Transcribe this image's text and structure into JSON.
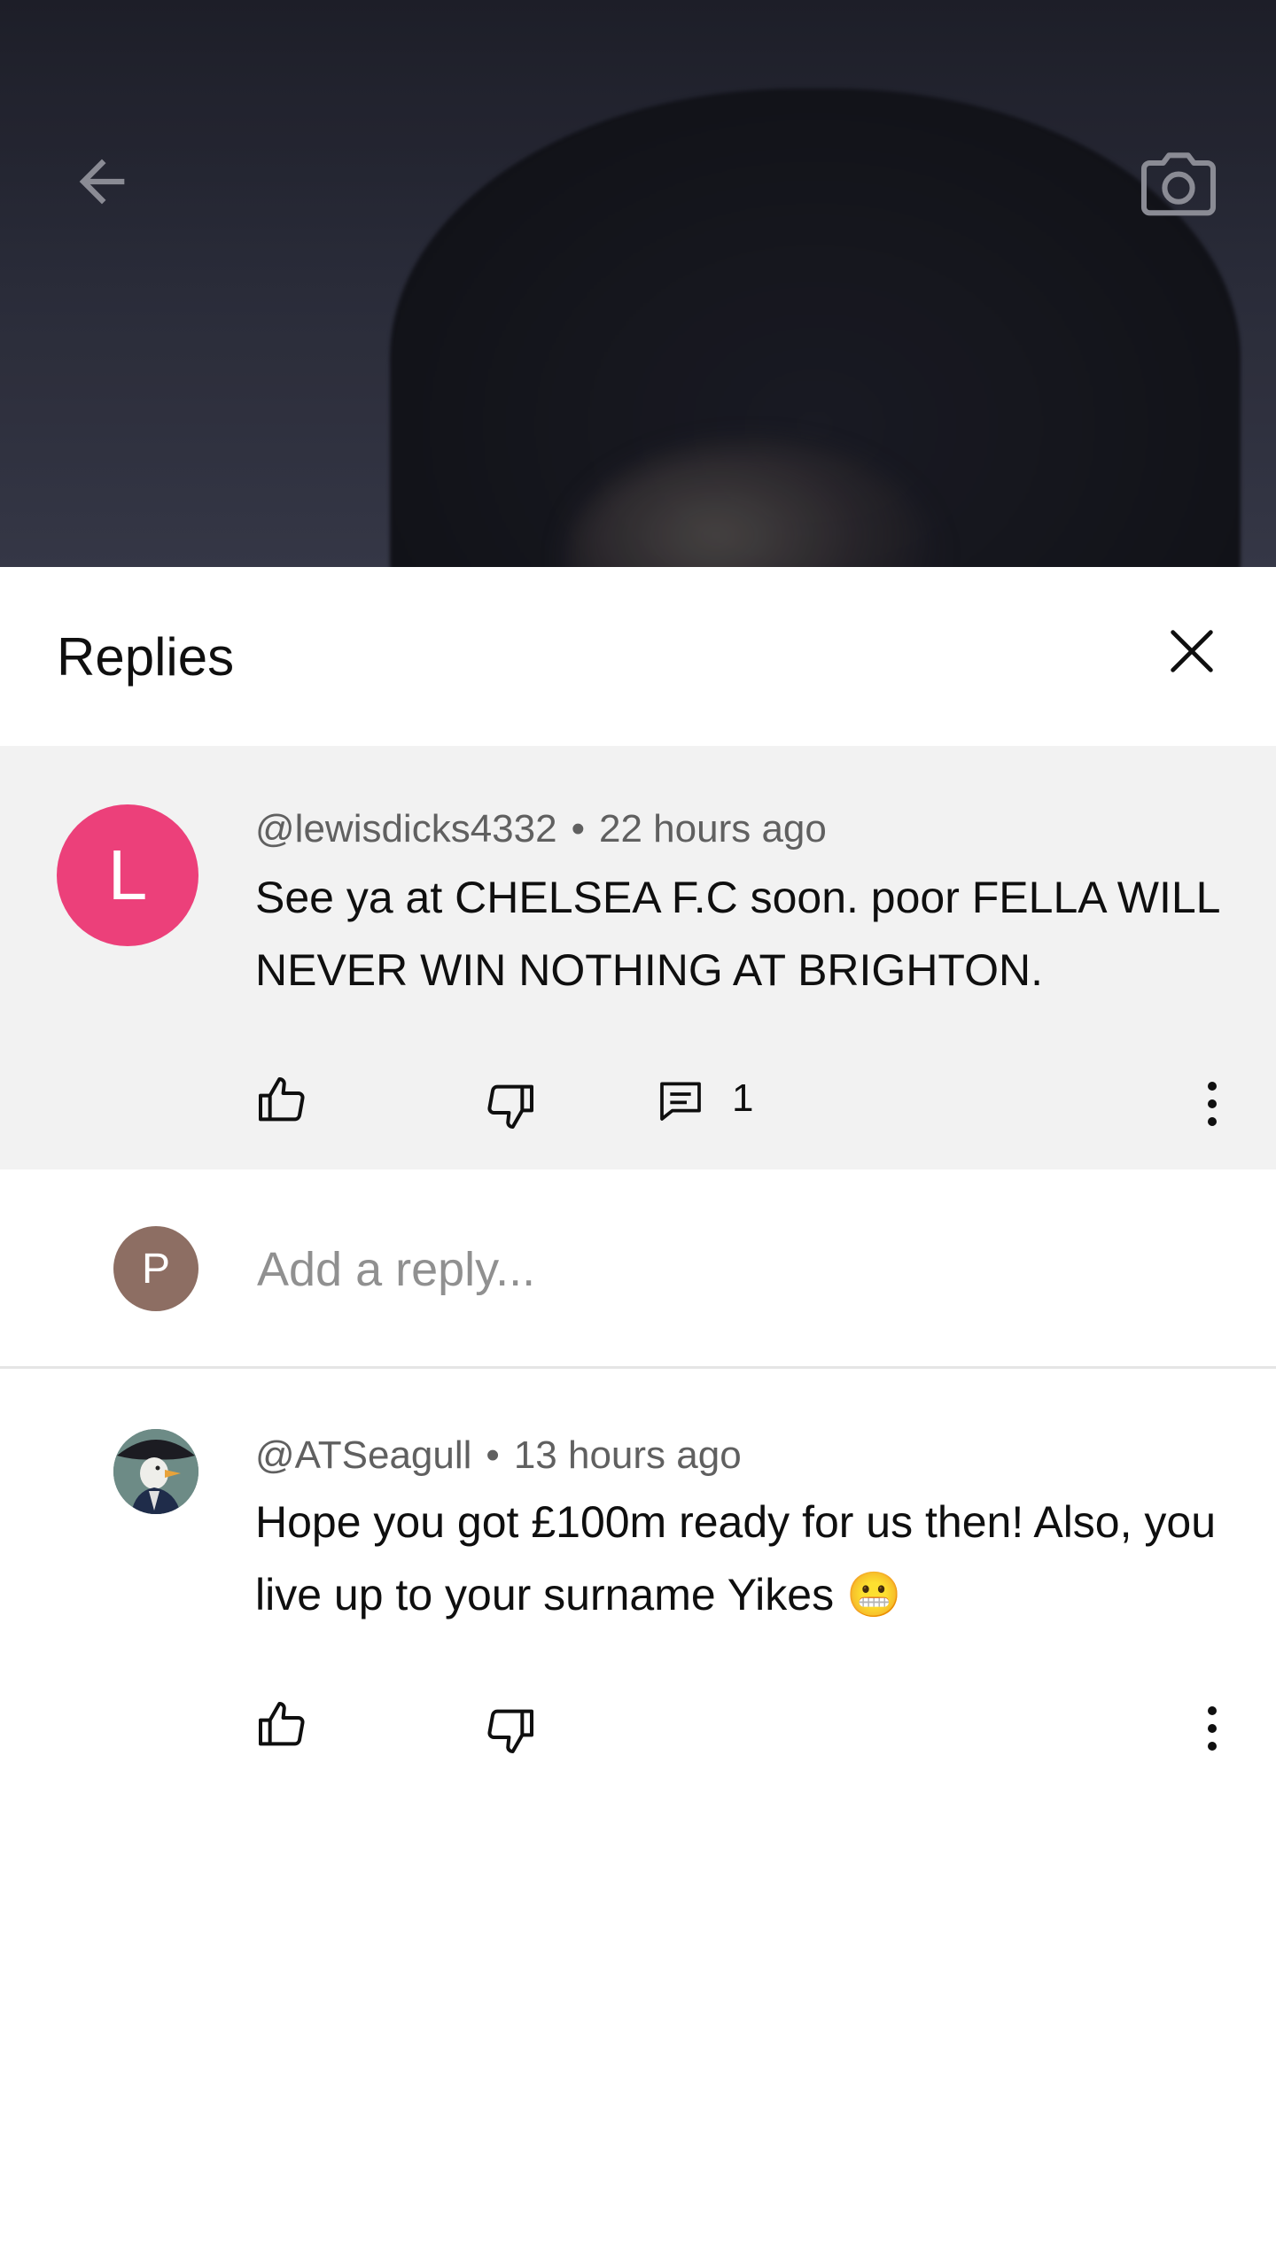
{
  "top_bar": {
    "back_icon": "arrow-left-icon",
    "camera_icon": "camera-icon"
  },
  "sheet": {
    "title": "Replies",
    "close_icon": "close-icon"
  },
  "parent_comment": {
    "avatar_letter": "L",
    "avatar_color": "#ec407a",
    "author": "@lewisdicks4332",
    "separator": "•",
    "time": "22 hours ago",
    "text": "See ya at CHELSEA F.C soon.  poor FELLA WILL NEVER WIN NOTHING AT BRIGHTON.",
    "reply_count": "1"
  },
  "reply_box": {
    "avatar_letter": "P",
    "avatar_color": "#8d6e63",
    "placeholder": "Add a reply..."
  },
  "replies": [
    {
      "author": "@ATSeagull",
      "separator": "•",
      "time": "13 hours ago",
      "text": "Hope you got £100m ready for us then! Also, you live up to your surname Yikes 😬"
    }
  ],
  "colors": {
    "sheet_background": "#ffffff",
    "highlight_background": "#f2f2f2",
    "secondary_text": "#606060",
    "placeholder_text": "#909090"
  }
}
